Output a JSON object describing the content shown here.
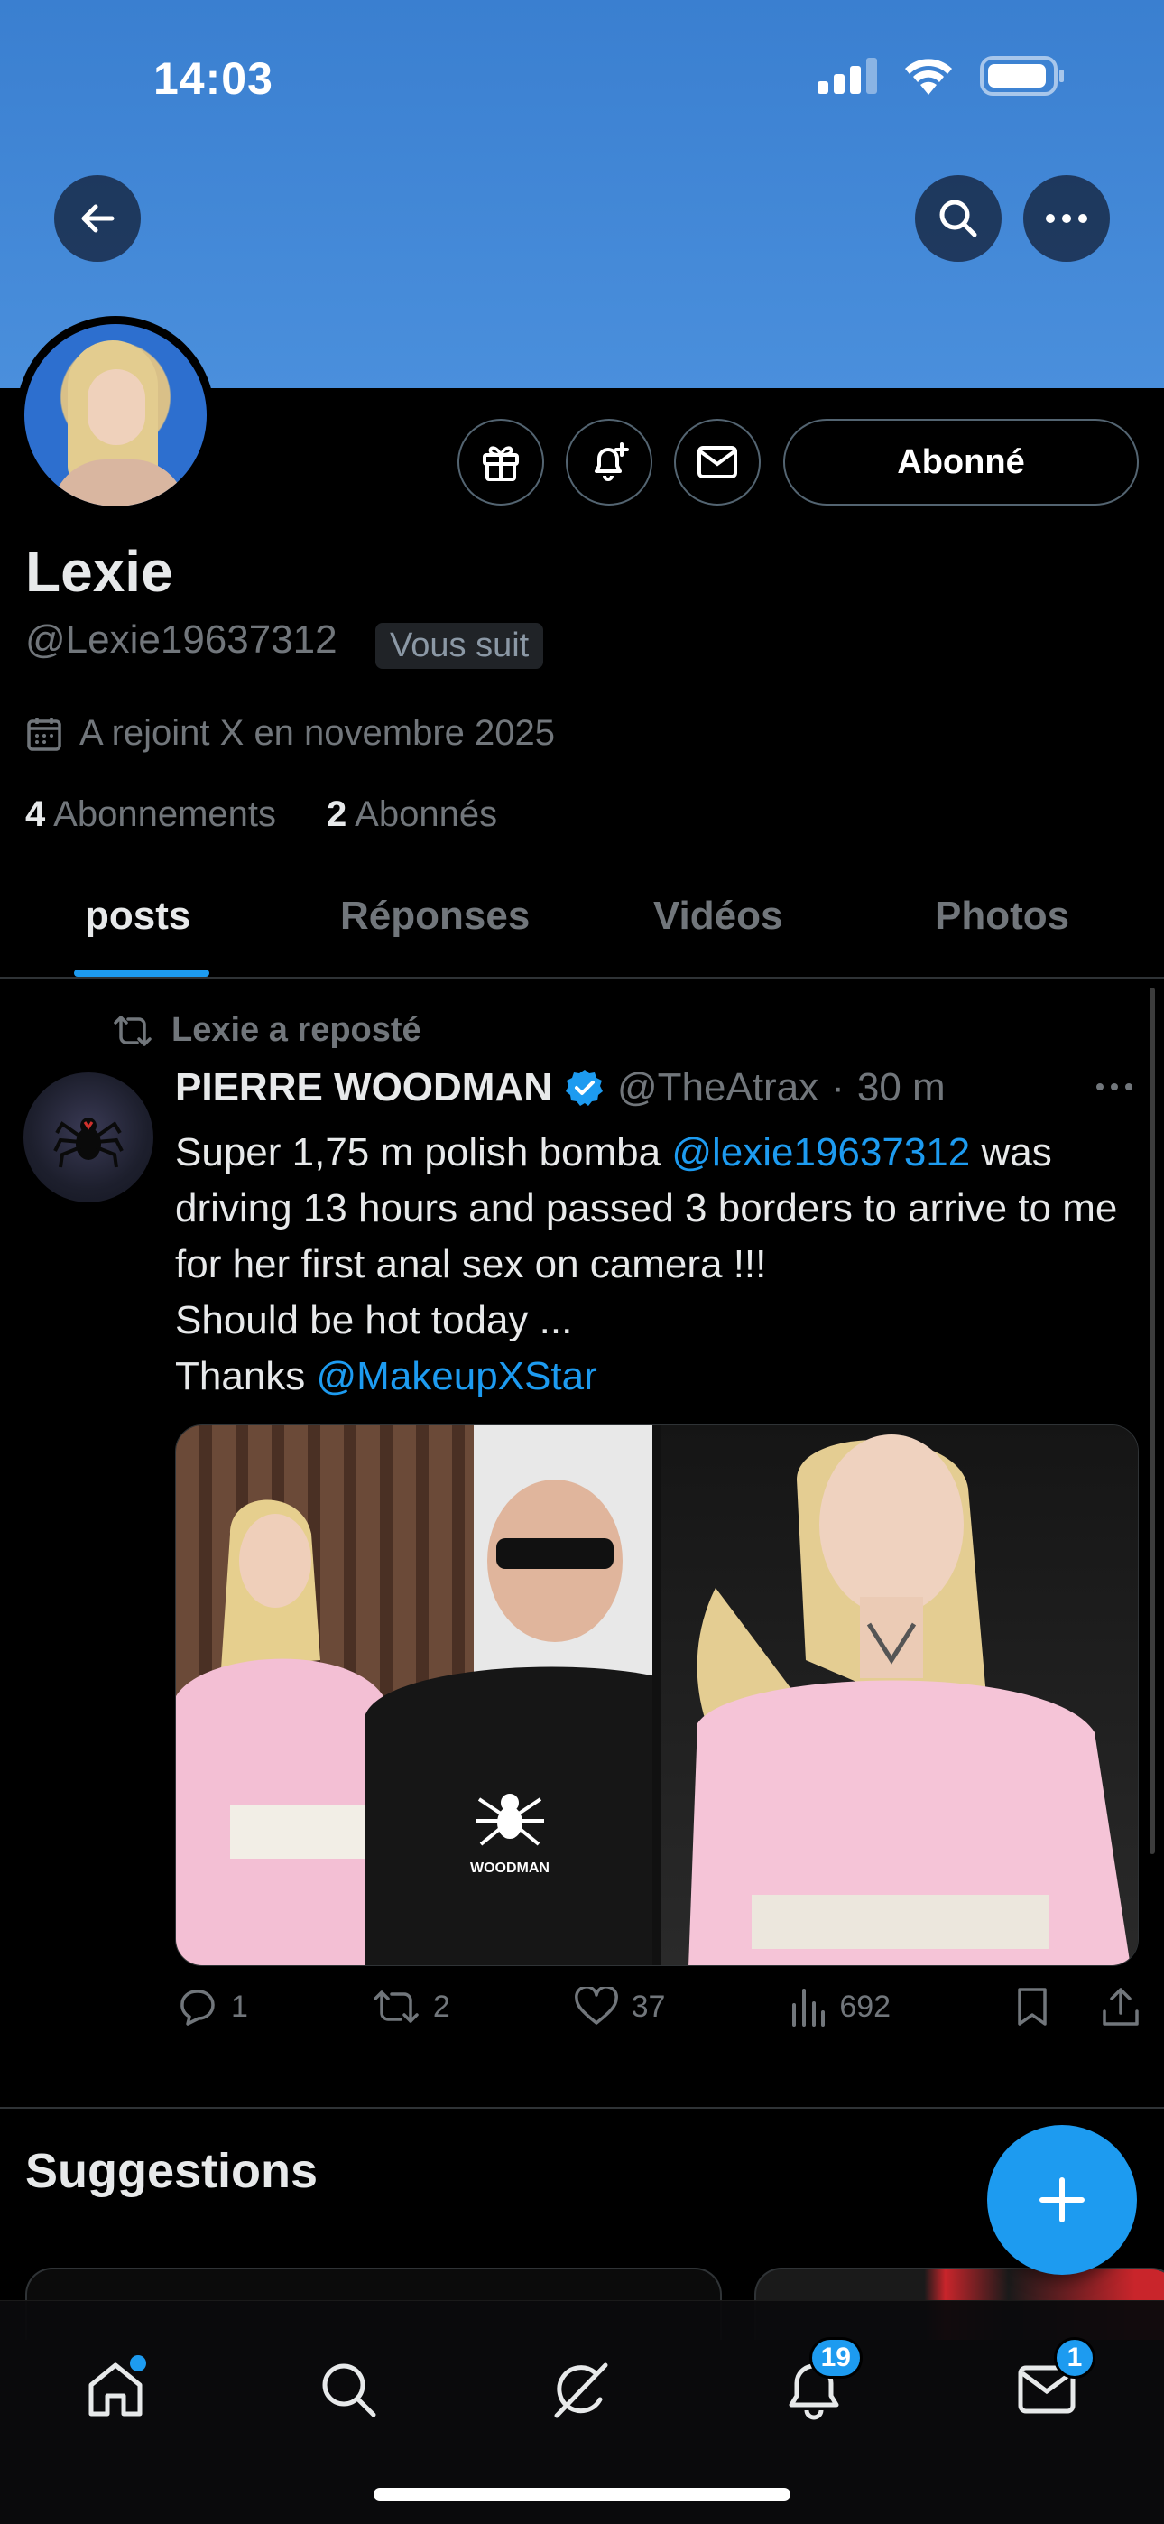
{
  "status_bar": {
    "time": "14:03"
  },
  "profile": {
    "name": "Lexie",
    "handle": "@Lexie19637312",
    "follows_you": "Vous suit",
    "joined": "A rejoint X en novembre 2025",
    "following_count": "4",
    "following_label": "Abonnements",
    "followers_count": "2",
    "followers_label": "Abonnés",
    "follow_button": "Abonné"
  },
  "tabs": [
    {
      "label": "posts",
      "active": true
    },
    {
      "label": "Réponses",
      "active": false
    },
    {
      "label": "Vidéos",
      "active": false
    },
    {
      "label": "Photos",
      "active": false
    }
  ],
  "post": {
    "repost_label": "Lexie a reposté",
    "author": "PIERRE WOODMAN",
    "author_handle": "@TheAtrax",
    "dot": "·",
    "time": "30 m",
    "text_1": "Super 1,75 m polish bomba ",
    "mention_1": "@lexie19637312",
    "text_2": " was driving 13 hours and passed 3 borders to arrive to me for her first anal sex on camera !!!",
    "text_3": "Should be hot today ...",
    "text_4": "Thanks ",
    "mention_2": "@MakeupXStar",
    "shirt_text": "WOODMAN",
    "replies": "1",
    "reposts": "2",
    "likes": "37",
    "views": "692"
  },
  "suggestions_title": "Suggestions",
  "nav": {
    "notifications_badge": "19",
    "messages_badge": "1"
  },
  "colors": {
    "accent": "#1d9bf0",
    "banner": "#4a8fdc",
    "background": "#000000"
  }
}
